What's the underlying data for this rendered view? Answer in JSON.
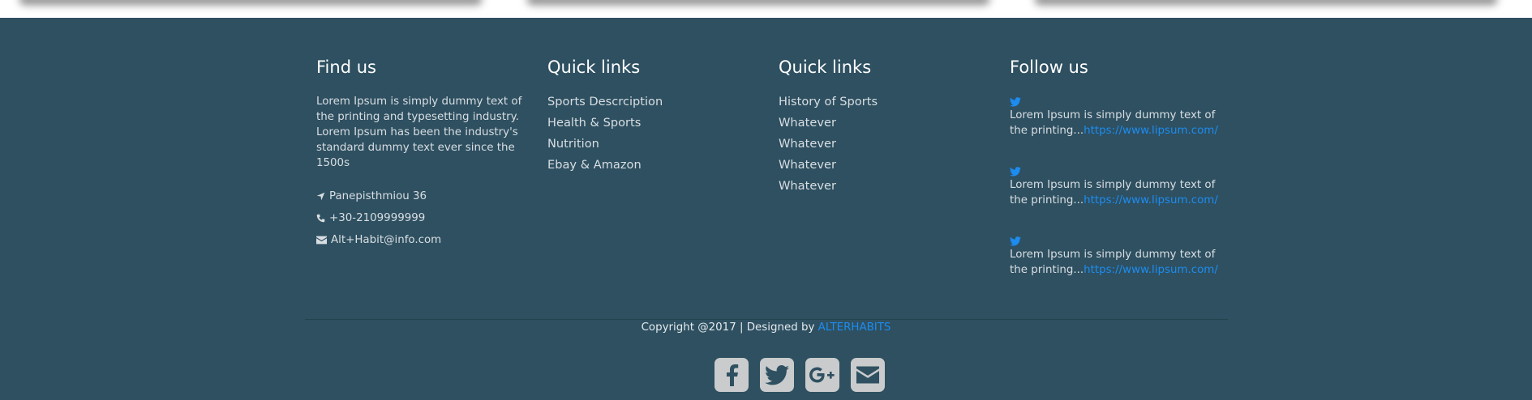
{
  "find_us": {
    "heading": "Find us",
    "about": "Lorem Ipsum is simply dummy text of the printing and typesetting industry. Lorem Ipsum has been the industry's standard dummy text ever since the 1500s",
    "address": "Panepisthmiou 36",
    "phone": "+30-2109999999",
    "email": "Alt+Habit@info.com"
  },
  "quick_links_1": {
    "heading": "Quick links",
    "items": [
      "Sports Descrciption",
      "Health & Sports",
      "Nutrition",
      "Ebay & Amazon"
    ]
  },
  "quick_links_2": {
    "heading": "Quick links",
    "items": [
      "History of Sports",
      "Whatever",
      "Whatever",
      "Whatever",
      "Whatever"
    ]
  },
  "follow_us": {
    "heading": "Follow us",
    "tweets": [
      {
        "text": "Lorem Ipsum is simply dummy text of the printing...",
        "link": "https://www.lipsum.com/"
      },
      {
        "text": "Lorem Ipsum is simply dummy text of the printing...",
        "link": "https://www.lipsum.com/"
      },
      {
        "text": "Lorem Ipsum is simply dummy text of the printing...",
        "link": "https://www.lipsum.com/"
      }
    ]
  },
  "copyright": {
    "text": "Copyright @2017 | Designed by",
    "designer": "ALTERHABITS"
  },
  "social_icons": [
    "facebook-icon",
    "twitter-icon",
    "google-plus-icon",
    "envelope-icon"
  ],
  "colors": {
    "footer_bg": "#2e5061",
    "link_blue": "#1d8cf0",
    "social_box": "#c9cbcc"
  }
}
